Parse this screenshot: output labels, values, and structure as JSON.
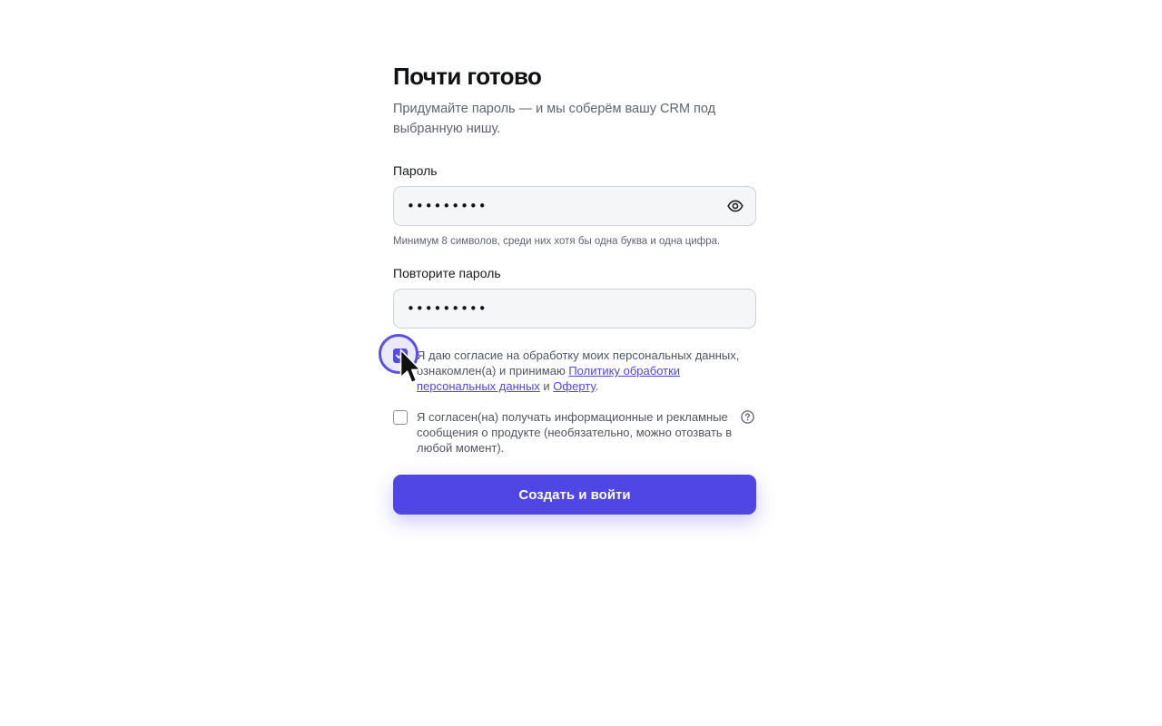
{
  "header": {
    "title": "Почти готово",
    "subtitle": "Придумайте пароль — и мы соберём вашу CRM под выбранную нишу."
  },
  "password": {
    "label": "Пароль",
    "value": "•••••••••",
    "toggle_icon": "eye-icon",
    "hint": "Минимум 8 символов, среди них хотя бы одна буква и одна цифра."
  },
  "password_repeat": {
    "label": "Повторите пароль",
    "value": "•••••••••"
  },
  "consent_personal": {
    "checked": true,
    "text_before": "Я даю согласие на обработку моих персональных данных, ознакомлен(а) и принимаю ",
    "policy_link": "Политику обработки персональных данных",
    "text_between": " и ",
    "offer_link": "Оферту",
    "text_after": "."
  },
  "consent_marketing": {
    "checked": false,
    "text": "Я согласен(на) получать информационные и рекламные сообщения о продукте (необязательно, можно отозвать в любой момент).",
    "help_icon": "question-circle-icon"
  },
  "submit": {
    "label": "Создать и войти"
  },
  "colors": {
    "accent": "#4f46e5",
    "text_muted": "#5f6470",
    "input_bg": "#f5f6f8"
  }
}
